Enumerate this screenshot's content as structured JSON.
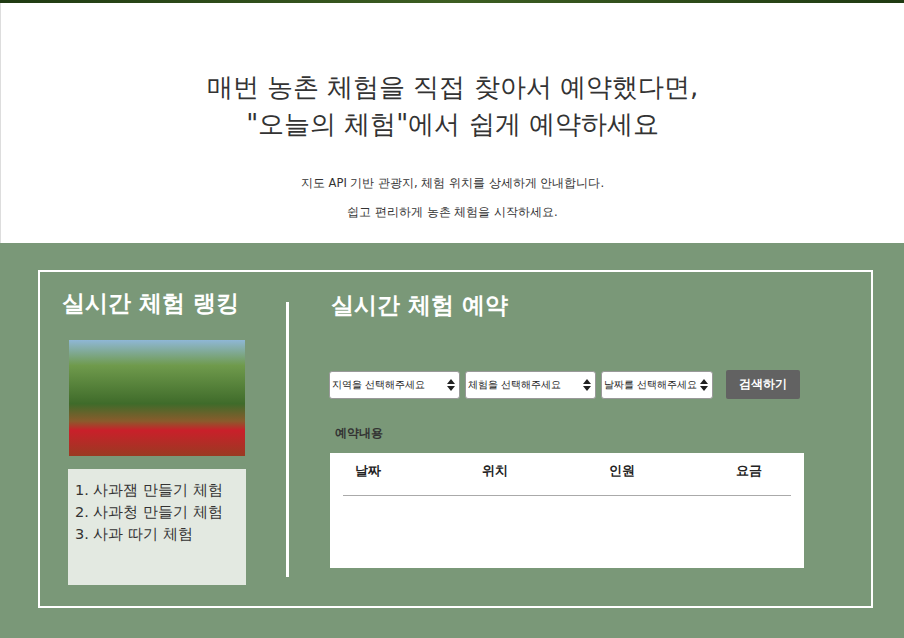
{
  "hero": {
    "title_lines": [
      "매번 농촌 체험을 직접 찾아서 예약했다면,",
      "\"오늘의 체험\"에서 쉽게 예약하세요"
    ],
    "subtitle_lines": [
      "지도 API 기반 관광지, 체험 위치를 상세하게 안내합니다.",
      "쉽고 편리하게 농촌 체험을 시작하세요."
    ]
  },
  "ranking": {
    "title": "실시간 체험 랭킹",
    "items": [
      "1. 사과잼 만들기 체험",
      "2. 사과청 만들기 체험",
      "3. 사과 따기 체험"
    ]
  },
  "reservation": {
    "title": "실시간 체험 예약",
    "selects": [
      "지역을 선택해주세요",
      "체험을 선택해주세요",
      "날짜를 선택해주세요"
    ],
    "button": "검색하기",
    "label": "예약내용",
    "table": {
      "columns": [
        "날짜",
        "위치",
        "인원",
        "요금"
      ],
      "rows": []
    }
  }
}
